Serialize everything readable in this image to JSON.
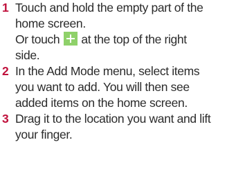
{
  "steps": [
    {
      "number": "1",
      "lines": [
        "Touch and hold the empty part of the",
        "home screen."
      ],
      "alt_prefix": "Or touch",
      "alt_suffix": "at the top of the right",
      "alt_line2": "side.",
      "icon": "plus-icon"
    },
    {
      "number": "2",
      "lines": [
        "In the Add Mode menu, select items",
        "you want to add. You will then see",
        "added items on the home screen."
      ]
    },
    {
      "number": "3",
      "lines": [
        "Drag it to the location you want and lift",
        "your finger."
      ]
    }
  ],
  "colors": {
    "number": "#c0113c",
    "text": "#2b2b2b",
    "plus_icon_bg": "#8fd16a"
  }
}
